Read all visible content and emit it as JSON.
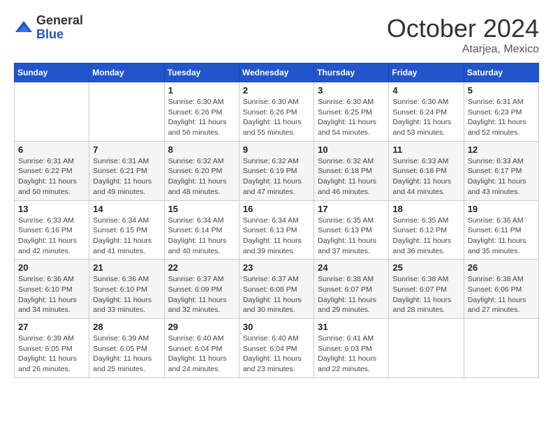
{
  "logo": {
    "general": "General",
    "blue": "Blue"
  },
  "title": "October 2024",
  "location": "Atarjea, Mexico",
  "days_of_week": [
    "Sunday",
    "Monday",
    "Tuesday",
    "Wednesday",
    "Thursday",
    "Friday",
    "Saturday"
  ],
  "weeks": [
    [
      {
        "day": "",
        "sunrise": "",
        "sunset": "",
        "daylight": ""
      },
      {
        "day": "",
        "sunrise": "",
        "sunset": "",
        "daylight": ""
      },
      {
        "day": "1",
        "sunrise": "Sunrise: 6:30 AM",
        "sunset": "Sunset: 6:26 PM",
        "daylight": "Daylight: 11 hours and 56 minutes."
      },
      {
        "day": "2",
        "sunrise": "Sunrise: 6:30 AM",
        "sunset": "Sunset: 6:26 PM",
        "daylight": "Daylight: 11 hours and 55 minutes."
      },
      {
        "day": "3",
        "sunrise": "Sunrise: 6:30 AM",
        "sunset": "Sunset: 6:25 PM",
        "daylight": "Daylight: 11 hours and 54 minutes."
      },
      {
        "day": "4",
        "sunrise": "Sunrise: 6:30 AM",
        "sunset": "Sunset: 6:24 PM",
        "daylight": "Daylight: 11 hours and 53 minutes."
      },
      {
        "day": "5",
        "sunrise": "Sunrise: 6:31 AM",
        "sunset": "Sunset: 6:23 PM",
        "daylight": "Daylight: 11 hours and 52 minutes."
      }
    ],
    [
      {
        "day": "6",
        "sunrise": "Sunrise: 6:31 AM",
        "sunset": "Sunset: 6:22 PM",
        "daylight": "Daylight: 11 hours and 50 minutes."
      },
      {
        "day": "7",
        "sunrise": "Sunrise: 6:31 AM",
        "sunset": "Sunset: 6:21 PM",
        "daylight": "Daylight: 11 hours and 49 minutes."
      },
      {
        "day": "8",
        "sunrise": "Sunrise: 6:32 AM",
        "sunset": "Sunset: 6:20 PM",
        "daylight": "Daylight: 11 hours and 48 minutes."
      },
      {
        "day": "9",
        "sunrise": "Sunrise: 6:32 AM",
        "sunset": "Sunset: 6:19 PM",
        "daylight": "Daylight: 11 hours and 47 minutes."
      },
      {
        "day": "10",
        "sunrise": "Sunrise: 6:32 AM",
        "sunset": "Sunset: 6:18 PM",
        "daylight": "Daylight: 11 hours and 46 minutes."
      },
      {
        "day": "11",
        "sunrise": "Sunrise: 6:33 AM",
        "sunset": "Sunset: 6:18 PM",
        "daylight": "Daylight: 11 hours and 44 minutes."
      },
      {
        "day": "12",
        "sunrise": "Sunrise: 6:33 AM",
        "sunset": "Sunset: 6:17 PM",
        "daylight": "Daylight: 11 hours and 43 minutes."
      }
    ],
    [
      {
        "day": "13",
        "sunrise": "Sunrise: 6:33 AM",
        "sunset": "Sunset: 6:16 PM",
        "daylight": "Daylight: 11 hours and 42 minutes."
      },
      {
        "day": "14",
        "sunrise": "Sunrise: 6:34 AM",
        "sunset": "Sunset: 6:15 PM",
        "daylight": "Daylight: 11 hours and 41 minutes."
      },
      {
        "day": "15",
        "sunrise": "Sunrise: 6:34 AM",
        "sunset": "Sunset: 6:14 PM",
        "daylight": "Daylight: 11 hours and 40 minutes."
      },
      {
        "day": "16",
        "sunrise": "Sunrise: 6:34 AM",
        "sunset": "Sunset: 6:13 PM",
        "daylight": "Daylight: 11 hours and 39 minutes."
      },
      {
        "day": "17",
        "sunrise": "Sunrise: 6:35 AM",
        "sunset": "Sunset: 6:13 PM",
        "daylight": "Daylight: 11 hours and 37 minutes."
      },
      {
        "day": "18",
        "sunrise": "Sunrise: 6:35 AM",
        "sunset": "Sunset: 6:12 PM",
        "daylight": "Daylight: 11 hours and 36 minutes."
      },
      {
        "day": "19",
        "sunrise": "Sunrise: 6:36 AM",
        "sunset": "Sunset: 6:11 PM",
        "daylight": "Daylight: 11 hours and 35 minutes."
      }
    ],
    [
      {
        "day": "20",
        "sunrise": "Sunrise: 6:36 AM",
        "sunset": "Sunset: 6:10 PM",
        "daylight": "Daylight: 11 hours and 34 minutes."
      },
      {
        "day": "21",
        "sunrise": "Sunrise: 6:36 AM",
        "sunset": "Sunset: 6:10 PM",
        "daylight": "Daylight: 11 hours and 33 minutes."
      },
      {
        "day": "22",
        "sunrise": "Sunrise: 6:37 AM",
        "sunset": "Sunset: 6:09 PM",
        "daylight": "Daylight: 11 hours and 32 minutes."
      },
      {
        "day": "23",
        "sunrise": "Sunrise: 6:37 AM",
        "sunset": "Sunset: 6:08 PM",
        "daylight": "Daylight: 11 hours and 30 minutes."
      },
      {
        "day": "24",
        "sunrise": "Sunrise: 6:38 AM",
        "sunset": "Sunset: 6:07 PM",
        "daylight": "Daylight: 11 hours and 29 minutes."
      },
      {
        "day": "25",
        "sunrise": "Sunrise: 6:38 AM",
        "sunset": "Sunset: 6:07 PM",
        "daylight": "Daylight: 11 hours and 28 minutes."
      },
      {
        "day": "26",
        "sunrise": "Sunrise: 6:38 AM",
        "sunset": "Sunset: 6:06 PM",
        "daylight": "Daylight: 11 hours and 27 minutes."
      }
    ],
    [
      {
        "day": "27",
        "sunrise": "Sunrise: 6:39 AM",
        "sunset": "Sunset: 6:05 PM",
        "daylight": "Daylight: 11 hours and 26 minutes."
      },
      {
        "day": "28",
        "sunrise": "Sunrise: 6:39 AM",
        "sunset": "Sunset: 6:05 PM",
        "daylight": "Daylight: 11 hours and 25 minutes."
      },
      {
        "day": "29",
        "sunrise": "Sunrise: 6:40 AM",
        "sunset": "Sunset: 6:04 PM",
        "daylight": "Daylight: 11 hours and 24 minutes."
      },
      {
        "day": "30",
        "sunrise": "Sunrise: 6:40 AM",
        "sunset": "Sunset: 6:04 PM",
        "daylight": "Daylight: 11 hours and 23 minutes."
      },
      {
        "day": "31",
        "sunrise": "Sunrise: 6:41 AM",
        "sunset": "Sunset: 6:03 PM",
        "daylight": "Daylight: 11 hours and 22 minutes."
      },
      {
        "day": "",
        "sunrise": "",
        "sunset": "",
        "daylight": ""
      },
      {
        "day": "",
        "sunrise": "",
        "sunset": "",
        "daylight": ""
      }
    ]
  ]
}
